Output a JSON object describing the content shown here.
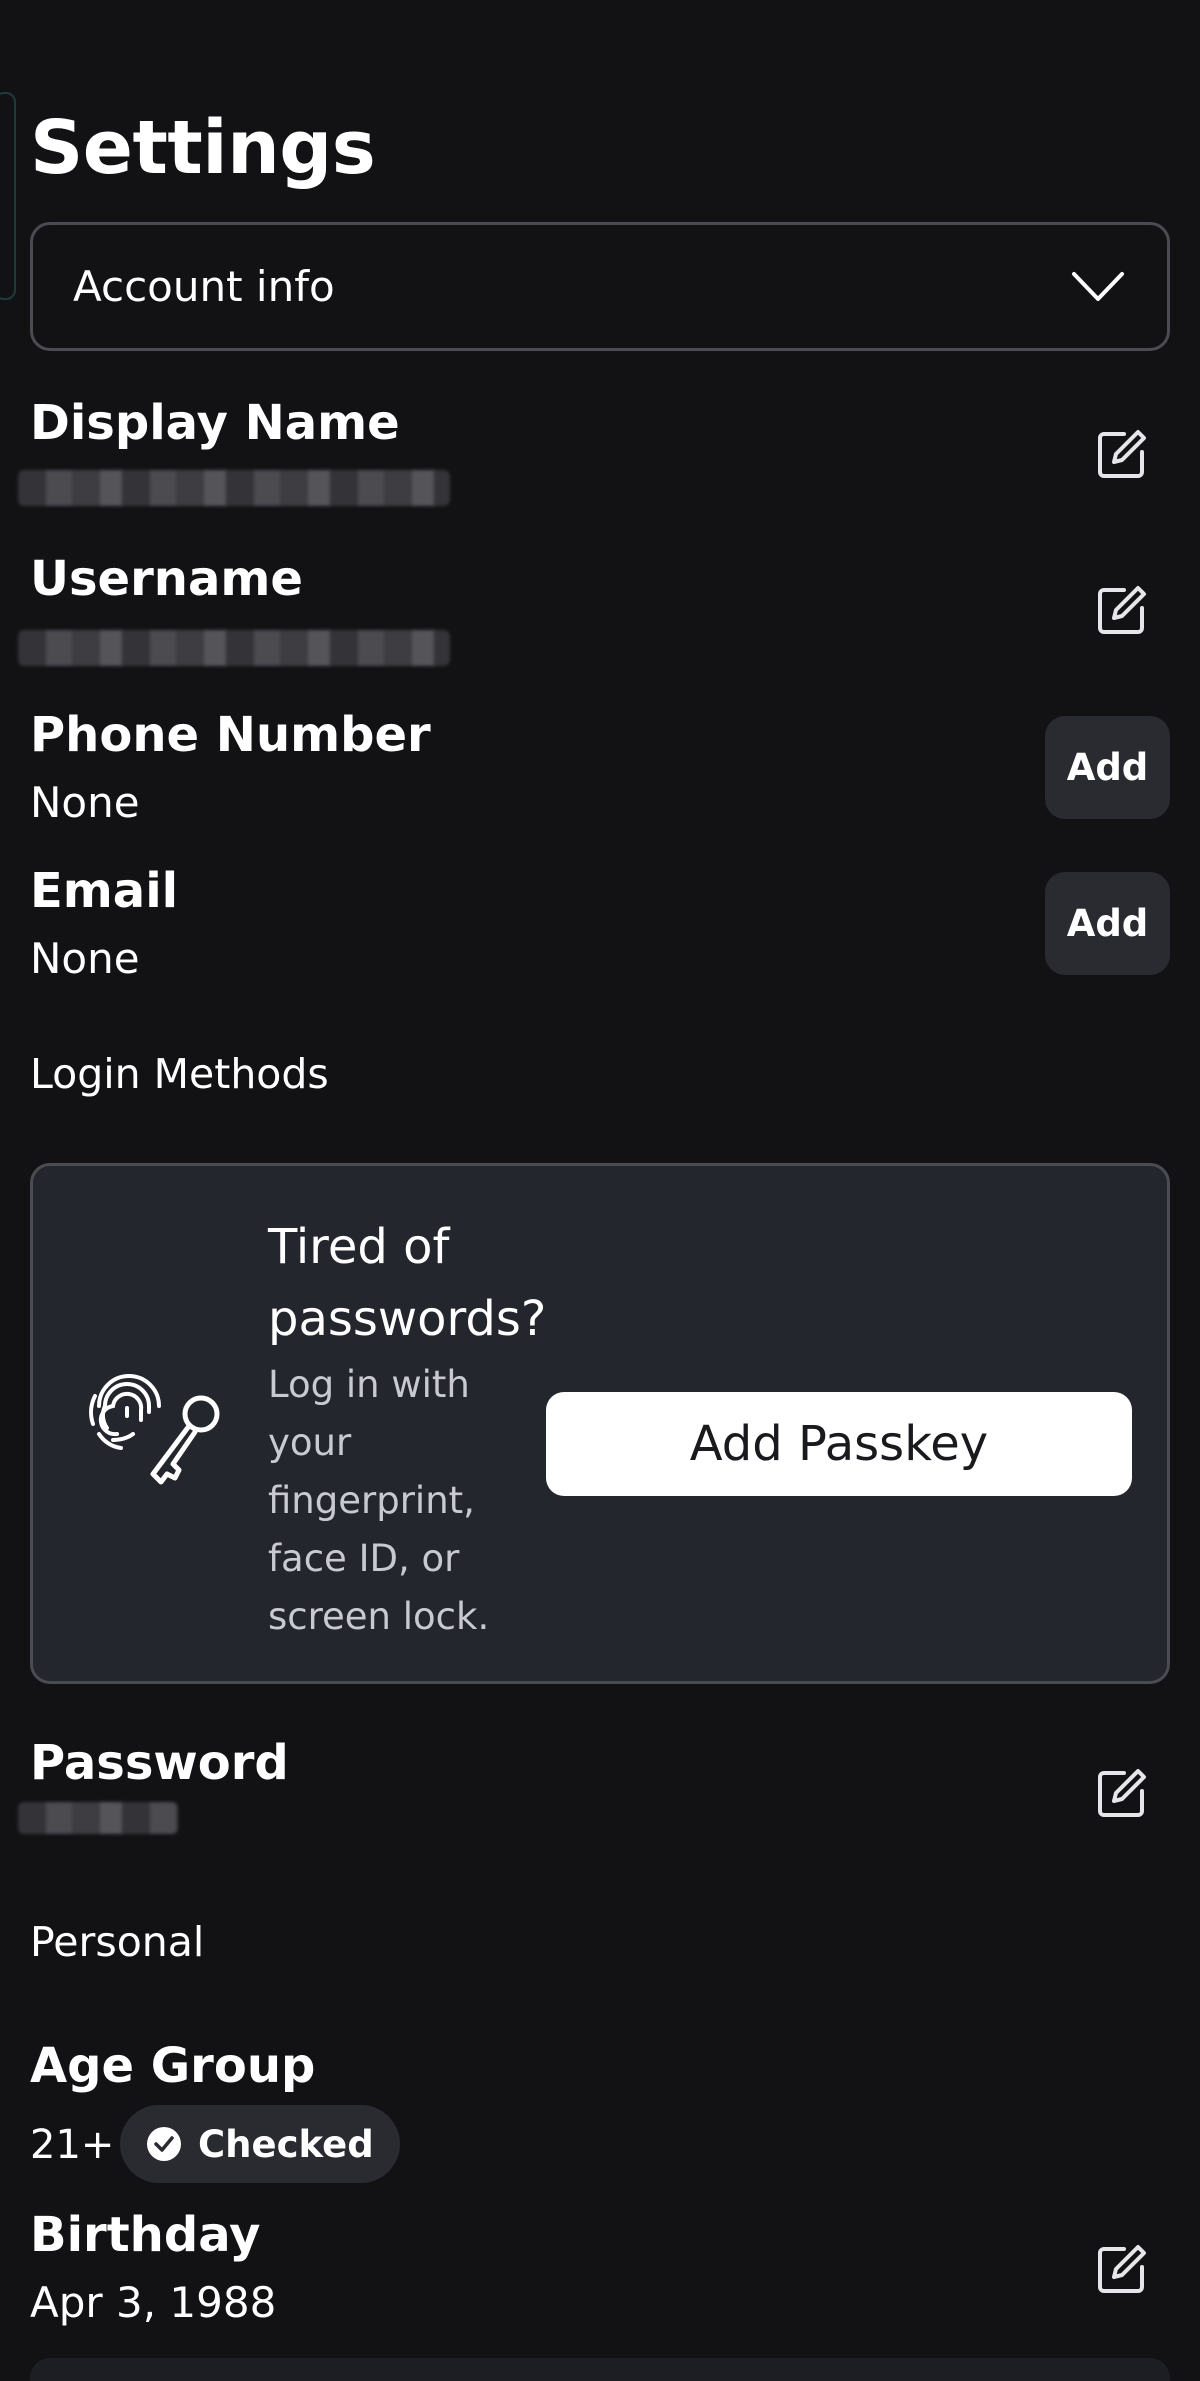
{
  "header": {
    "title": "Settings"
  },
  "dropdown": {
    "selected": "Account info",
    "icon": "chevron-down-icon"
  },
  "account": {
    "display_name": {
      "label": "Display Name",
      "icon": "edit-icon"
    },
    "username": {
      "label": "Username",
      "icon": "edit-icon"
    },
    "phone": {
      "label": "Phone Number",
      "value": "None",
      "button": "Add"
    },
    "email": {
      "label": "Email",
      "value": "None",
      "button": "Add"
    }
  },
  "login_methods": {
    "section_label": "Login Methods",
    "passkey_card": {
      "heading": "Tired of passwords?",
      "description": "Log in with your fingerprint, face ID, or screen lock.",
      "button": "Add Passkey",
      "icon": "fingerprint-key-icon"
    },
    "password": {
      "label": "Password",
      "icon": "edit-icon"
    }
  },
  "personal": {
    "section_label": "Personal",
    "age_group": {
      "label": "Age Group",
      "value": "21+",
      "badge": "Checked"
    },
    "birthday": {
      "label": "Birthday",
      "value": "Apr 3, 1988",
      "icon": "edit-icon"
    }
  },
  "colors": {
    "background": "#121215",
    "card": "#24262e",
    "button_secondary": "#2a2b31",
    "border": "#4b4b52",
    "primary_button": "#ffffff"
  }
}
